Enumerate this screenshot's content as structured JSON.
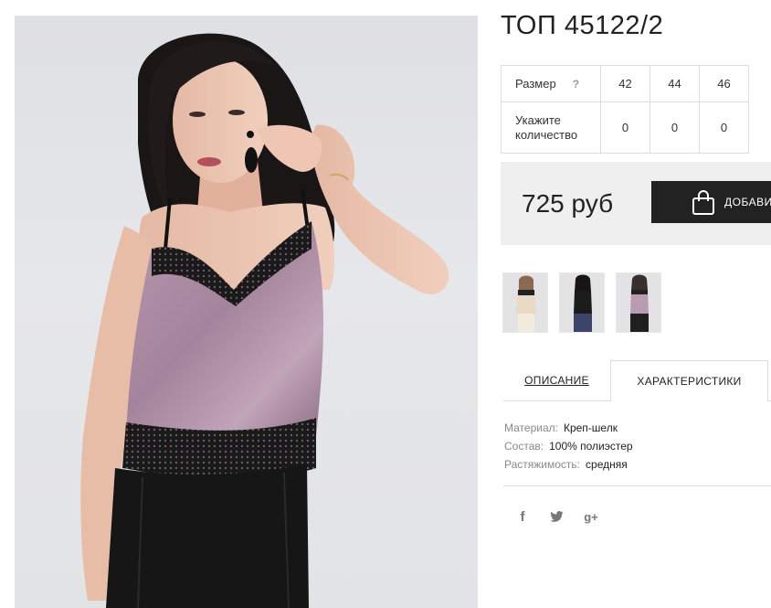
{
  "product": {
    "title": "ТОП 45122/2",
    "image_alt": "product-photo-model-lilac-satin-top"
  },
  "size_table": {
    "size_label": "Размер",
    "help_mark": "?",
    "sizes": [
      "42",
      "44",
      "46"
    ],
    "qty_label": "Укажите количество",
    "quantities": [
      "0",
      "0",
      "0"
    ]
  },
  "purchase": {
    "price": "725 руб",
    "add_button_label": "ДОБАВИТЬ В КОРЗИНУ",
    "add_icon": "shopping-bag-icon"
  },
  "thumbnails": [
    {
      "name": "thumb-beige"
    },
    {
      "name": "thumb-black"
    },
    {
      "name": "thumb-lilac"
    }
  ],
  "tabs": {
    "description": "ОПИСАНИЕ",
    "characteristics": "ХАРАКТЕРИСТИКИ",
    "active": "characteristics"
  },
  "characteristics": {
    "material_key": "Материал:",
    "material_value": "Креп-шелк",
    "composition_key": "Состав:",
    "composition_value": "100% полиэстер",
    "stretch_key": "Растяжимость:",
    "stretch_value": "средняя"
  },
  "social": {
    "facebook": "f",
    "twitter": "twitter-icon",
    "googleplus": "g+"
  },
  "colors": {
    "price_bar_bg": "#efefef",
    "button_bg": "#222222",
    "top_lilac": "#a98aa3",
    "lace_black": "#151515"
  }
}
